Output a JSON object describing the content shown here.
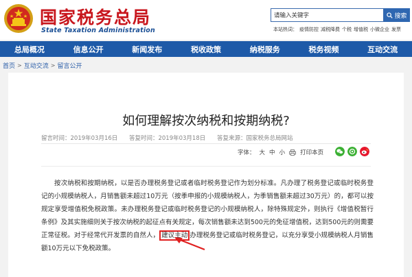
{
  "site": {
    "title": "国家税务总局",
    "subtitle": "State Taxation Administration"
  },
  "search": {
    "placeholder": "请输入关键字",
    "button_label": "搜索",
    "hot_label": "本站热词：",
    "hot_words": [
      "疫情防控",
      "减税降费",
      "个税",
      "增值税",
      "小微企业",
      "发票"
    ]
  },
  "nav": {
    "items": [
      "总局概况",
      "信息公开",
      "新闻发布",
      "税收政策",
      "纳税服务",
      "税务视频",
      "互动交流"
    ]
  },
  "breadcrumb": {
    "items": [
      "首页",
      "互动交流",
      "留言公开"
    ],
    "separator": ">"
  },
  "article": {
    "title": "如何理解按次纳税和按期纳税?",
    "leave_date": "留言时间：2019年03月16日",
    "answer_date": "答复时间：2019年03月18日",
    "source": "答复来源：国家税务总局网站",
    "font_label": "字体：",
    "font_sizes": [
      "大",
      "中",
      "小"
    ],
    "print_label": "打印本页",
    "body_before": "按次纳税和按期纳税，以是否办理税务登记或者临时税务登记作为划分标准。凡办理了税务登记或临时税务登记的小规模纳税人，月销售额未超过10万元（按季申报的小规模纳税人，为季销售额未超过30万元）的，都可以按规定享受增值税免税政策。未办理税务登记或临时税务登记的小规模纳税人，除特殊规定外，则执行《增值税暂行条例》及其实施细则关于按次纳税的起征点有关规定，每次销售额未达到500元的免征增值税，达到500元的则需要正常征税。对于经常代开发票的自然人，",
    "body_highlight": "建议主动",
    "body_after": "办理税务登记或临时税务登记，以充分享受小规模纳税人月销售额10万元以下免税政策。"
  },
  "colors": {
    "brand_red": "#c8161d",
    "nav_blue": "#1e5aa8",
    "link_blue": "#2b5ea8",
    "highlight_red": "#e02020"
  }
}
